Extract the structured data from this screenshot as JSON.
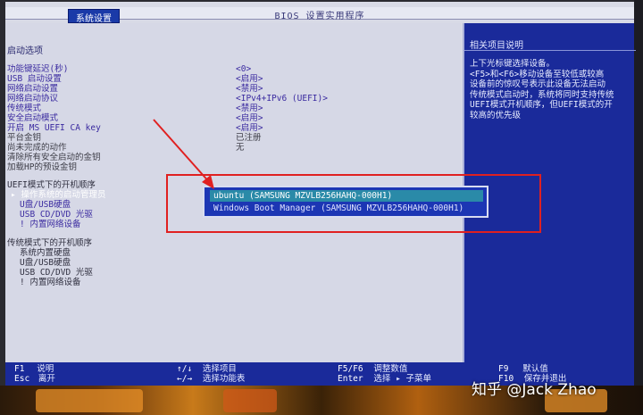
{
  "title_bar": {
    "title": "BIOS 设置实用程序",
    "tab": "系统设置"
  },
  "main": {
    "section_title": "启动选项",
    "settings": [
      {
        "label": "功能键延迟(秒)",
        "value": "<0>",
        "active": true
      },
      {
        "label": "USB 启动设置",
        "value": "<启用>",
        "active": true
      },
      {
        "label": "网络启动设置",
        "value": "<禁用>",
        "active": true
      },
      {
        "label": "网络启动协议",
        "value": "<IPv4+IPv6 (UEFI)>",
        "active": true
      },
      {
        "label": "传统模式",
        "value": "<禁用>",
        "active": true
      },
      {
        "label": "安全启动模式",
        "value": "<启用>",
        "active": true
      },
      {
        "label": "开启 MS UEFI CA key",
        "value": "<启用>",
        "active": true
      },
      {
        "label": "平台金钥",
        "value": "已注册",
        "active": false
      },
      {
        "label": "尚未完成的动作",
        "value": "无",
        "active": false
      },
      {
        "label": "清除所有安全启动的金钥",
        "value": "",
        "active": false
      },
      {
        "label": "加载HP的预设金钥",
        "value": "",
        "active": false
      }
    ],
    "uefi_order": {
      "title": "UEFI模式下的开机顺序",
      "items": [
        "▸ 操作系统的启动管理员",
        "U盘/USB硬盘",
        "USB CD/DVD 光驱",
        "! 内置网络设备"
      ]
    },
    "legacy_order": {
      "title": "传统模式下的开机顺序",
      "items": [
        "系统内置硬盘",
        "U盘/USB硬盘",
        "USB CD/DVD 光驱",
        "! 内置网络设备"
      ]
    }
  },
  "popup": {
    "options": [
      "ubuntu (SAMSUNG MZVLB256HAHQ-000H1)",
      "Windows Boot Manager (SAMSUNG MZVLB256HAHQ-000H1)"
    ],
    "selected_index": 0
  },
  "help": {
    "title": "相关项目说明",
    "lines": [
      "上下光标键选择设备。",
      "<F5>和<F6>移动设备至较低或较高",
      "设备前的惊叹号表示此设备无法启动",
      "传统模式启动时，系统将同时支持传统",
      "UEFI模式开机顺序，但UEFI模式的开",
      "较高的优先级"
    ]
  },
  "bottom_bar": {
    "keys": [
      {
        "key": "F1",
        "desc": "说明"
      },
      {
        "key": "Esc",
        "desc": "离开"
      },
      {
        "key": "↑/↓",
        "desc": "选择项目"
      },
      {
        "key": "←/→",
        "desc": "选择功能表"
      },
      {
        "key": "F5/F6",
        "desc": "调整数值"
      },
      {
        "key": "Enter",
        "desc": "选择 ▸ 子菜单"
      },
      {
        "key": "F9",
        "desc": "默认值"
      },
      {
        "key": "F10",
        "desc": "保存并退出"
      }
    ]
  },
  "watermark": "知乎 @Jack Zhao",
  "colors": {
    "bios_blue": "#1a2a9a",
    "panel_gray": "#d6d8e6",
    "highlight_teal": "#2a8aa8",
    "annotation_red": "#e02020"
  }
}
